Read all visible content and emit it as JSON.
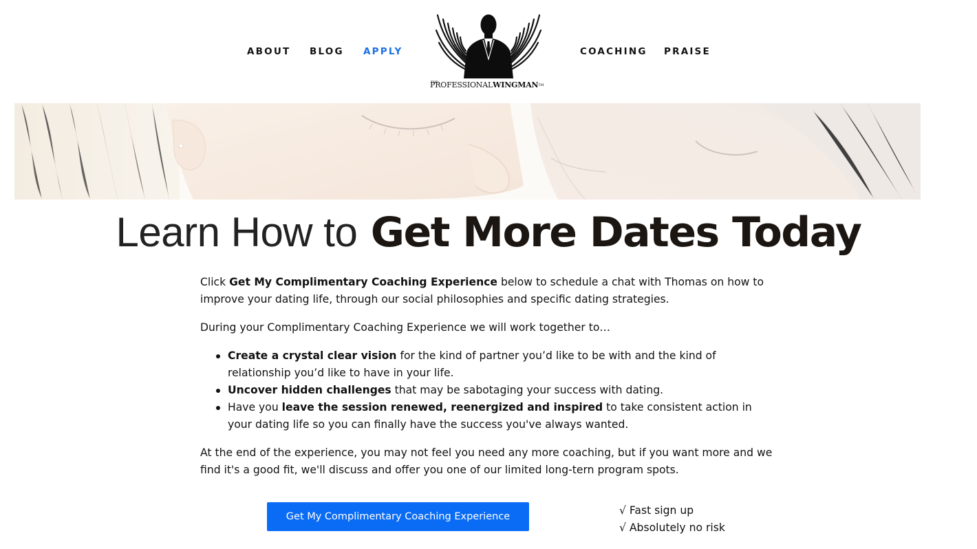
{
  "nav": {
    "left": [
      {
        "label": "ABOUT"
      },
      {
        "label": "BLOG"
      },
      {
        "label": "APPLY",
        "active": true
      }
    ],
    "right": [
      {
        "label": "COACHING"
      },
      {
        "label": "PRAISE"
      }
    ],
    "active_color": "#1a6fe8"
  },
  "logo": {
    "prefix": "THE",
    "word1": "PROFESSIONAL",
    "word2": "WINGMAN",
    "trademark": "TM"
  },
  "headline": {
    "light": "Learn How to",
    "bold": "Get More Dates Today"
  },
  "intro": {
    "pre": "Click ",
    "bold": "Get My Complimentary Coaching Experience",
    "post": " below to schedule a chat with Thomas on how to improve your dating life, through our social philosophies and specific dating strategies."
  },
  "lead_in": "During your Complimentary Coaching Experience we will work together to…",
  "bullets": [
    {
      "pre": "",
      "bold": "Create a crystal clear vision",
      "post": " for the kind of partner you’d like to be with and the kind of relationship you’d like to have in your life."
    },
    {
      "pre": "",
      "bold": "Uncover hidden challenges",
      "post": " that may be sabotaging your success with dating."
    },
    {
      "pre": "Have you ",
      "bold": "leave the session renewed, reenergized and inspired",
      "post": " to take consistent action in your dating life so you can finally have the success you've always wanted."
    }
  ],
  "closing": "At the end of the experience, you may not feel you need any more coaching, but if you want more and we find it's a good fit, we'll discuss and offer you one of our limited long-tern program spots.",
  "cta": {
    "label": "Get My Complimentary Coaching Experience",
    "color": "#0a6cf5"
  },
  "checks": [
    "√ Fast sign up",
    "√ Absolutely no risk"
  ]
}
